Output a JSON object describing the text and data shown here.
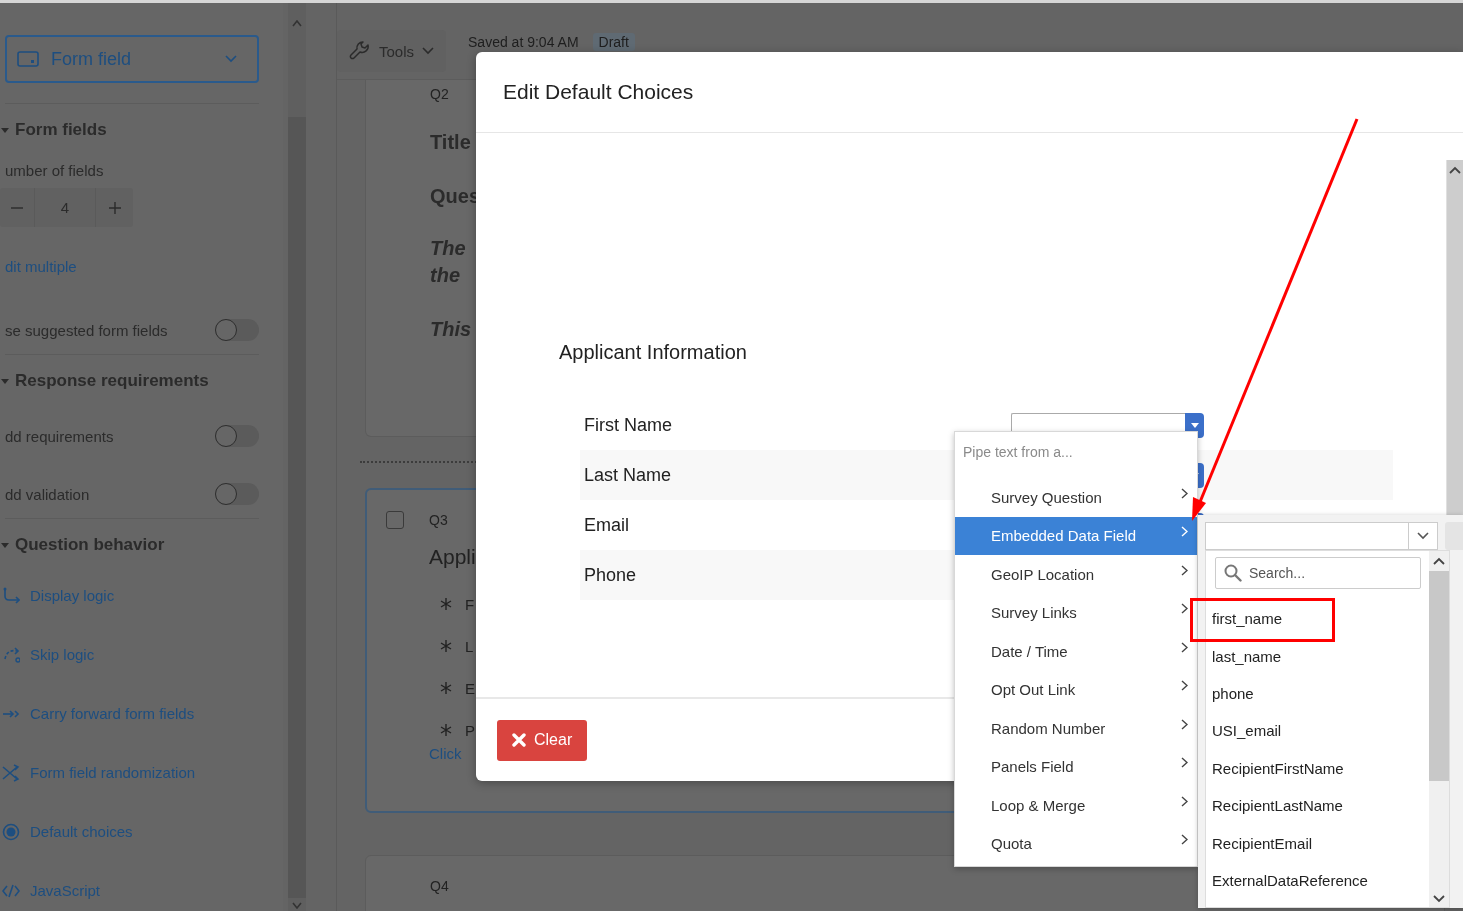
{
  "sidebar": {
    "question_type": "Form field",
    "sections": [
      {
        "title": "Form fields",
        "expanded": true,
        "items": [
          {
            "kind": "label",
            "text": "umber of fields"
          },
          {
            "kind": "stepper",
            "value": "4"
          },
          {
            "kind": "link",
            "text": "dit multiple"
          },
          {
            "kind": "toggle",
            "text": "se suggested form fields",
            "on": false
          }
        ]
      },
      {
        "title": "Response requirements",
        "expanded": true,
        "items": [
          {
            "kind": "toggle",
            "text": "dd requirements",
            "on": false
          },
          {
            "kind": "toggle",
            "text": "dd validation",
            "on": false
          }
        ]
      },
      {
        "title": "Question behavior",
        "expanded": true,
        "items": [
          {
            "kind": "action",
            "text": "Display logic"
          },
          {
            "kind": "action",
            "text": "Skip logic"
          },
          {
            "kind": "action",
            "text": "Carry forward form fields"
          },
          {
            "kind": "action",
            "text": "Form field randomization"
          },
          {
            "kind": "action",
            "text": "Default choices"
          },
          {
            "kind": "action",
            "text": "JavaScript"
          }
        ]
      }
    ]
  },
  "toolbar": {
    "tools": "Tools",
    "saved": "Saved at 9:04 AM",
    "status": "Draft"
  },
  "questions": [
    {
      "number": "Q2",
      "lines": [
        {
          "kind": "title",
          "text": "Title"
        },
        {
          "kind": "title",
          "text": "Ques"
        },
        {
          "kind": "italic",
          "text": "The"
        },
        {
          "kind": "italic",
          "text": "the"
        },
        {
          "kind": "italic",
          "text": "This"
        }
      ]
    },
    {
      "number": "Q3",
      "checked": false,
      "heading": "Appli",
      "choices": [
        "F",
        "L",
        "E",
        "P"
      ],
      "link": "Click"
    },
    {
      "number": "Q4"
    }
  ],
  "modal": {
    "title": "Edit Default Choices",
    "heading": "Applicant Information",
    "rows": [
      {
        "label": "First Name"
      },
      {
        "label": "Last Name"
      },
      {
        "label": "Email"
      },
      {
        "label": "Phone"
      }
    ],
    "clear": "Clear"
  },
  "pipe_menu": {
    "placeholder": "Pipe text from a...",
    "items": [
      {
        "label": "Survey Question",
        "selected": false
      },
      {
        "label": "Embedded Data Field",
        "selected": true
      },
      {
        "label": "GeoIP Location",
        "selected": false
      },
      {
        "label": "Survey Links",
        "selected": false
      },
      {
        "label": "Date / Time",
        "selected": false
      },
      {
        "label": "Opt Out Link",
        "selected": false
      },
      {
        "label": "Random Number",
        "selected": false
      },
      {
        "label": "Panels Field",
        "selected": false
      },
      {
        "label": "Loop & Merge",
        "selected": false
      },
      {
        "label": "Quota",
        "selected": false
      }
    ]
  },
  "field_list": {
    "search_placeholder": "Search...",
    "items": [
      {
        "label": "first_name",
        "highlighted": true
      },
      {
        "label": "last_name",
        "highlighted": false
      },
      {
        "label": "phone",
        "highlighted": false
      },
      {
        "label": "USI_email",
        "highlighted": false
      },
      {
        "label": "RecipientFirstName",
        "highlighted": false
      },
      {
        "label": "RecipientLastName",
        "highlighted": false
      },
      {
        "label": "RecipientEmail",
        "highlighted": false
      },
      {
        "label": "ExternalDataReference",
        "highlighted": false
      }
    ]
  }
}
